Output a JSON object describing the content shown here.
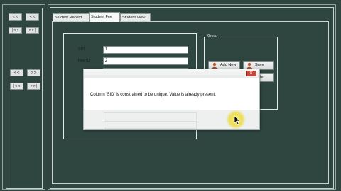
{
  "nav": {
    "first_label": "<<",
    "prev_label": "<",
    "next_label": ">",
    "last_label": ">>",
    "prev2_label": "<<",
    "next2_label": ">>",
    "first2_label": "|<<",
    "last2_label": ">>|"
  },
  "tabs": [
    {
      "label": "Student Record"
    },
    {
      "label": "Student Fee"
    },
    {
      "label": "Student View"
    }
  ],
  "form": {
    "fields": [
      {
        "label": "SID",
        "value": "1"
      },
      {
        "label": "Fee ID",
        "value": "2"
      }
    ]
  },
  "actions": {
    "group_caption": "Group",
    "add_new_label": "Add New",
    "save_label": "Save",
    "update_label": "Date"
  },
  "dialog": {
    "close_glyph": "✕",
    "message": "Column 'SID' is constrained to be unique.  Value        is already present."
  },
  "colors": {
    "background": "#2e4540",
    "dialog_close": "#c7463e",
    "cursor_highlight": "#f0e24a"
  }
}
